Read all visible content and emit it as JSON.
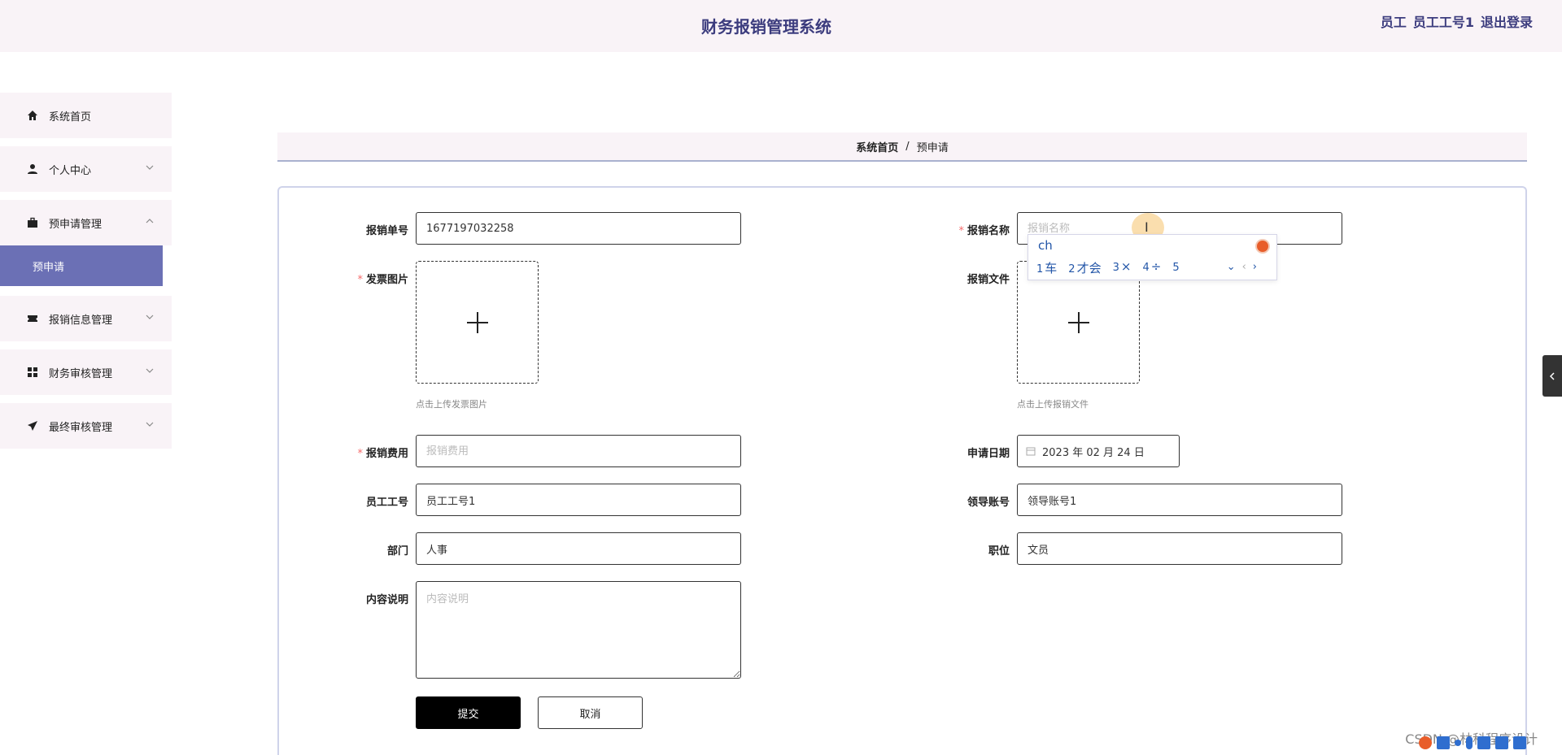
{
  "header": {
    "title": "财务报销管理系统",
    "user_role": "员工",
    "user_name": "员工工号1",
    "logout_label": "退出登录"
  },
  "sidebar": {
    "items": [
      {
        "label": "系统首页",
        "icon": "home-icon"
      },
      {
        "label": "个人中心",
        "icon": "user-icon"
      },
      {
        "label": "预申请管理",
        "icon": "briefcase-icon",
        "expanded": true
      },
      {
        "label": "报销信息管理",
        "icon": "ticket-icon"
      },
      {
        "label": "财务审核管理",
        "icon": "grid-icon"
      },
      {
        "label": "最终审核管理",
        "icon": "send-icon"
      }
    ],
    "active_sub": "预申请"
  },
  "breadcrumb": {
    "home": "系统首页",
    "separator": "/",
    "current": "预申请"
  },
  "form": {
    "bill_no": {
      "label": "报销单号",
      "value": "1677197032258"
    },
    "bill_name": {
      "label": "报销名称",
      "placeholder": "报销名称"
    },
    "invoice_image": {
      "label": "发票图片",
      "tip": "点击上传发票图片"
    },
    "bill_file": {
      "label": "报销文件",
      "tip": "点击上传报销文件"
    },
    "cost": {
      "label": "报销费用",
      "placeholder": "报销费用"
    },
    "apply_date": {
      "label": "申请日期",
      "value": "2023 年 02 月 24 日"
    },
    "employee_no": {
      "label": "员工工号",
      "value": "员工工号1"
    },
    "leader_account": {
      "label": "领导账号",
      "value": "领导账号1"
    },
    "department": {
      "label": "部门",
      "value": "人事"
    },
    "position": {
      "label": "职位",
      "value": "文员"
    },
    "content": {
      "label": "内容说明",
      "placeholder": "内容说明"
    },
    "submit_label": "提交",
    "cancel_label": "取消"
  },
  "ime": {
    "composition": "ch",
    "candidates": [
      {
        "num": "1",
        "text": "车"
      },
      {
        "num": "2",
        "text": "才会"
      },
      {
        "num": "3",
        "text": "×"
      },
      {
        "num": "4",
        "text": "÷"
      },
      {
        "num": "5",
        "text": ""
      }
    ]
  },
  "watermark": "CSDN @林科程序设计",
  "colors": {
    "accent": "#6b70b5",
    "header_bg": "#f9f3f7",
    "title": "#3c3c7e",
    "required": "#f56c6c"
  }
}
